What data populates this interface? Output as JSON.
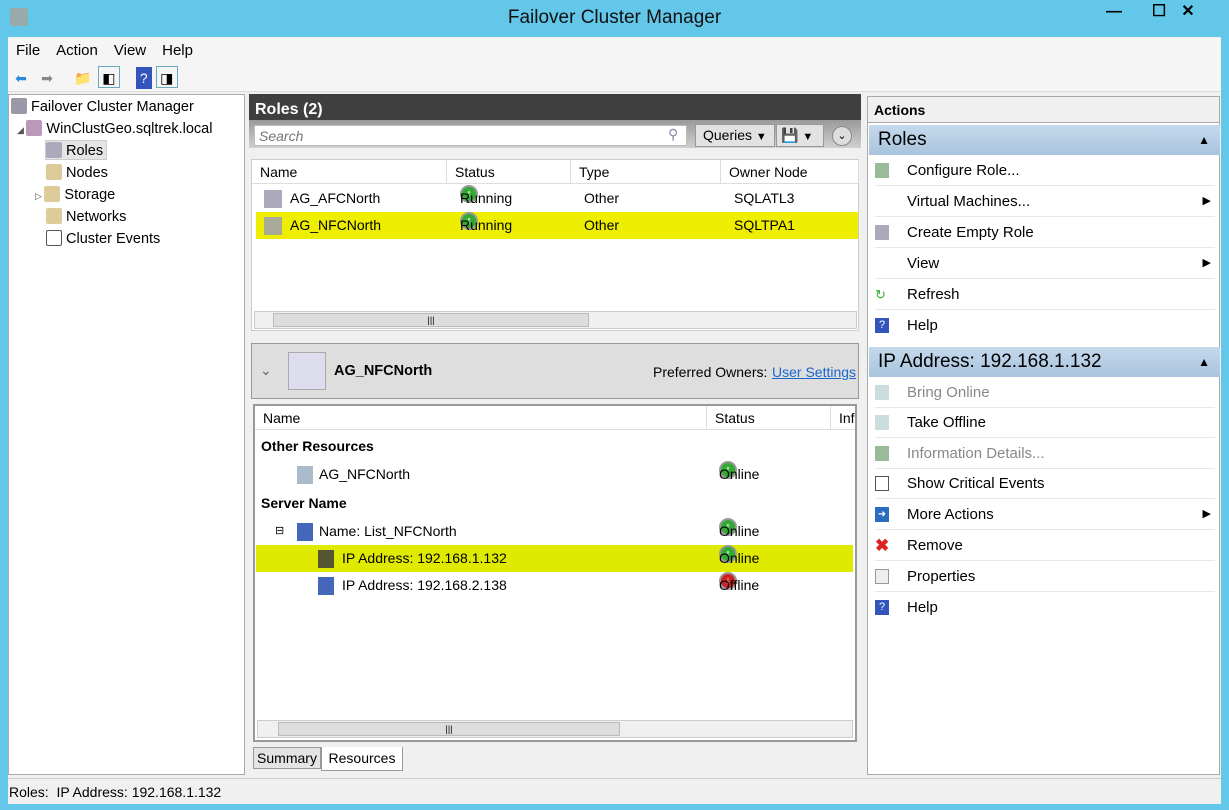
{
  "window": {
    "title": "Failover Cluster Manager",
    "minimize": "—",
    "maximize": "☐",
    "close": "✕"
  },
  "menu": [
    "File",
    "Action",
    "View",
    "Help"
  ],
  "tree": {
    "root": "Failover Cluster Manager",
    "cluster": "WinClustGeo.sqltrek.local",
    "items": [
      "Roles",
      "Nodes",
      "Storage",
      "Networks",
      "Cluster Events"
    ]
  },
  "roles": {
    "title": "Roles (2)",
    "search_placeholder": "Search",
    "queries": "Queries",
    "columns": [
      "Name",
      "Status",
      "Type",
      "Owner Node"
    ],
    "rows": [
      {
        "name": "AG_AFCNorth",
        "status": "Running",
        "type": "Other",
        "owner": "SQLATL3"
      },
      {
        "name": "AG_NFCNorth",
        "status": "Running",
        "type": "Other",
        "owner": "SQLTPA1"
      }
    ]
  },
  "details": {
    "title": "AG_NFCNorth",
    "preferred_label": "Preferred Owners:",
    "preferred_link": "User Settings",
    "columns": [
      "Name",
      "Status",
      "Inf"
    ],
    "groups": [
      "Other Resources",
      "Server Name"
    ],
    "resources": [
      {
        "name": "AG_NFCNorth",
        "status": "Online"
      },
      {
        "name": "Name: List_NFCNorth",
        "status": "Online"
      },
      {
        "name": "IP Address: 192.168.1.132",
        "status": "Online"
      },
      {
        "name": "IP Address: 192.168.2.138",
        "status": "Offline"
      }
    ],
    "tabs": [
      "Summary",
      "Resources"
    ]
  },
  "actions": {
    "title": "Actions",
    "section1": "Roles",
    "items1": [
      "Configure Role...",
      "Virtual Machines...",
      "Create Empty Role",
      "View",
      "Refresh",
      "Help"
    ],
    "section2": "IP Address: 192.168.1.132",
    "items2": [
      "Bring Online",
      "Take Offline",
      "Information Details...",
      "Show Critical Events",
      "More Actions",
      "Remove",
      "Properties",
      "Help"
    ]
  },
  "status": "Roles:  IP Address: 192.168.1.132",
  "colors": {
    "highlight": "#eeee00",
    "frame": "#63c7e9",
    "section": "#b8cfe6"
  }
}
